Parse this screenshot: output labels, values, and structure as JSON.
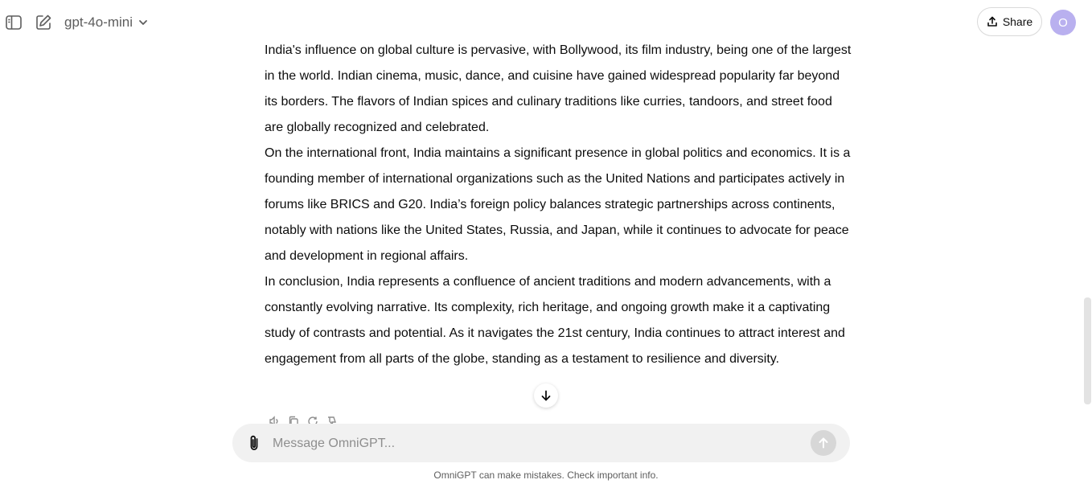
{
  "topbar": {
    "sidebar_toggle_icon": "sidebar-icon",
    "new_chat_icon": "edit-icon",
    "model_name": "gpt-4o-mini",
    "share_label": "Share",
    "avatar_initial": "O"
  },
  "message": {
    "paragraphs": [
      "India's influence on global culture is pervasive, with Bollywood, its film industry, being one of the largest in the world. Indian cinema, music, dance, and cuisine have gained widespread popularity far beyond its borders. The flavors of Indian spices and culinary traditions like curries, tandoors, and street food are globally recognized and celebrated.",
      "On the international front, India maintains a significant presence in global politics and economics. It is a founding member of international organizations such as the United Nations and participates actively in forums like BRICS and G20. India’s foreign policy balances strategic partnerships across continents, notably with nations like the United States, Russia, and Japan, while it continues to advocate for peace and development in regional affairs.",
      "In conclusion, India represents a confluence of ancient traditions and modern advancements, with a constantly evolving narrative. Its complexity, rich heritage, and ongoing growth make it a captivating study of contrasts and potential. As it navigates the 21st century, India continues to attract interest and engagement from all parts of the globe, standing as a testament to resilience and diversity."
    ],
    "actions": [
      "speaker-icon",
      "copy-icon",
      "regenerate-icon",
      "dislike-icon"
    ]
  },
  "composer": {
    "placeholder": "Message OmniGPT...",
    "value": ""
  },
  "footer": {
    "disclaimer": "OmniGPT can make mistakes. Check important info."
  },
  "colors": {
    "avatar": "#b9b0ef",
    "composer_bg": "#f1f1f1",
    "send_disabled": "#d7d7d7"
  }
}
